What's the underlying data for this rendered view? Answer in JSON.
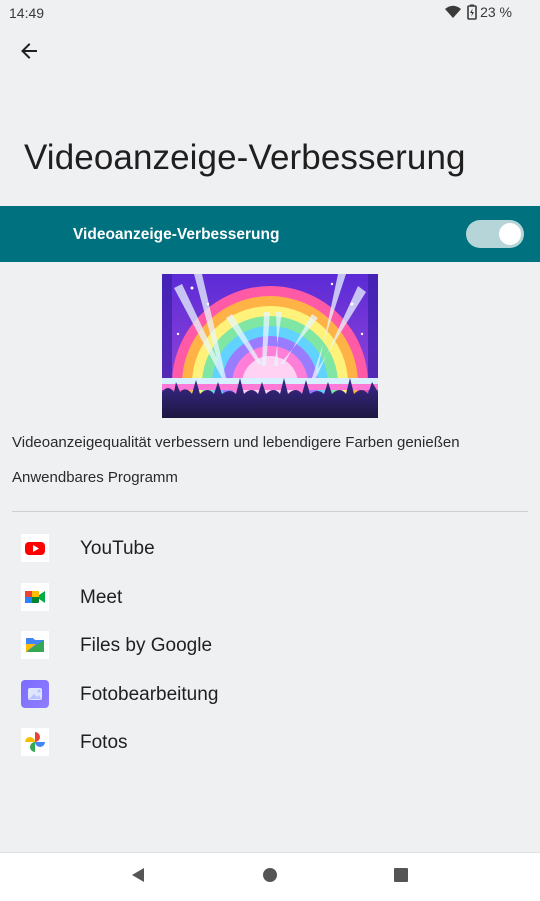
{
  "status_bar": {
    "time": "14:49",
    "battery": "23 %",
    "icons": [
      "wifi-icon",
      "battery-charging-icon"
    ]
  },
  "header": {
    "back_icon": "arrow-back-icon",
    "title": "Videoanzeige-Verbesserung"
  },
  "toggle": {
    "label": "Videoanzeige-Verbesserung",
    "checked": true,
    "bar_color": "#00717f"
  },
  "illustration": {
    "icon": "concert-stage-illustration"
  },
  "description": "Videoanzeigequalität verbessern und lebendigere Farben genießen",
  "apps_section": {
    "label": "Anwendbares Programm",
    "apps": [
      {
        "name": "YouTube",
        "icon": "youtube-icon"
      },
      {
        "name": "Meet",
        "icon": "meet-icon"
      },
      {
        "name": "Files by Google",
        "icon": "files-icon"
      },
      {
        "name": "Fotobearbeitung",
        "icon": "photo-editor-icon"
      },
      {
        "name": "Fotos",
        "icon": "photos-icon"
      }
    ]
  },
  "nav_bar": {
    "buttons": [
      "back-triangle-icon",
      "home-circle-icon",
      "recents-square-icon"
    ]
  }
}
